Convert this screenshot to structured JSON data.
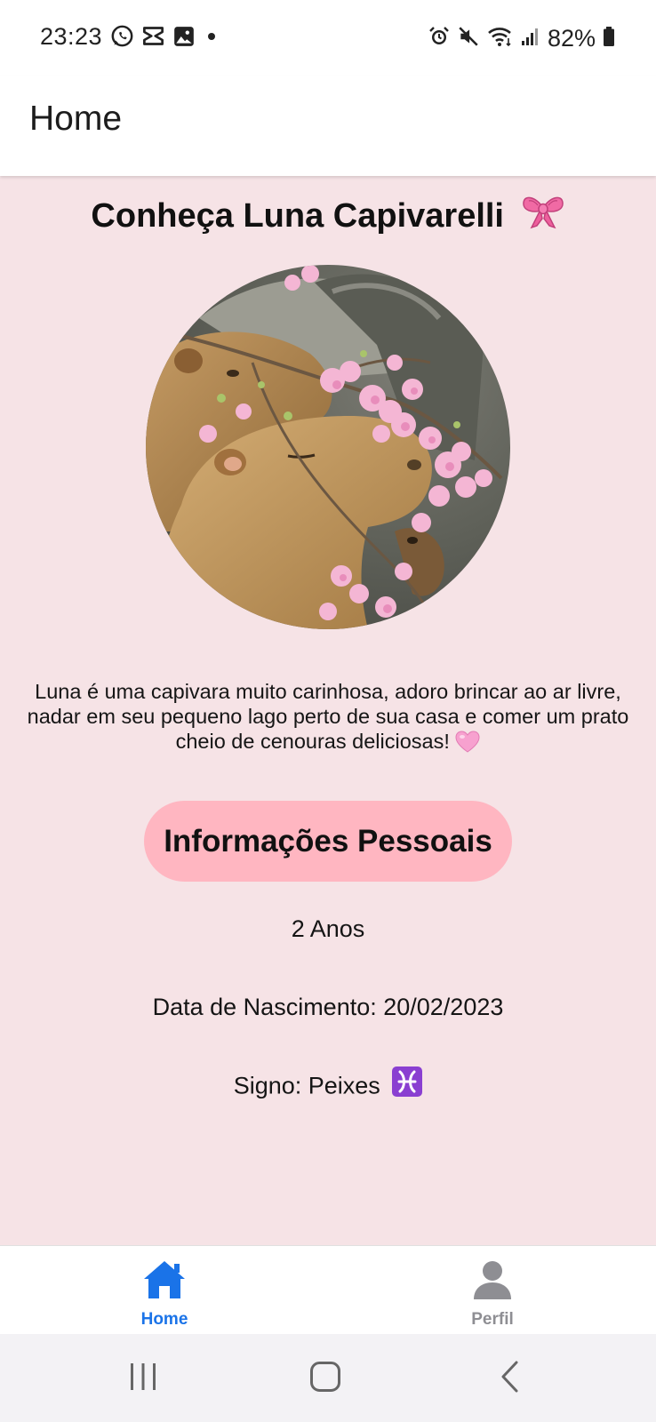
{
  "status_bar": {
    "time": "23:23",
    "battery": "82%",
    "left_icons": [
      "whatsapp-icon",
      "capcut-icon",
      "gallery-icon",
      "dot-icon"
    ],
    "right_icons": [
      "alarm-icon",
      "mute-icon",
      "wifi-icon",
      "signal-icon",
      "battery-icon"
    ]
  },
  "header": {
    "title": "Home"
  },
  "profile": {
    "title": "Conheça Luna Capivarelli",
    "title_icon": "ribbon-bow-icon",
    "photo": "capybara-cherry-blossom-photo",
    "description": "Luna é uma capivara muito carinhosa, adoro brincar ao ar livre, nadar em seu pequeno lago perto de sua casa e comer um prato cheio de cenouras deliciosas!",
    "description_icon": "pink-heart-icon"
  },
  "info_button": {
    "label": "Informações Pessoais",
    "color": "#ffb6c1"
  },
  "info": {
    "age": "2 Anos",
    "birth": "Data de Nascimento: 20/02/2023",
    "sign": "Signo: Peixes",
    "sign_icon": "pisces-icon"
  },
  "tabs": [
    {
      "label": "Home",
      "icon": "home-icon",
      "active": true,
      "color": "#1a73e8"
    },
    {
      "label": "Perfil",
      "icon": "person-icon",
      "active": false,
      "color": "#8e8e93"
    }
  ],
  "colors": {
    "background": "#f6e3e6",
    "accent": "#1a73e8"
  }
}
